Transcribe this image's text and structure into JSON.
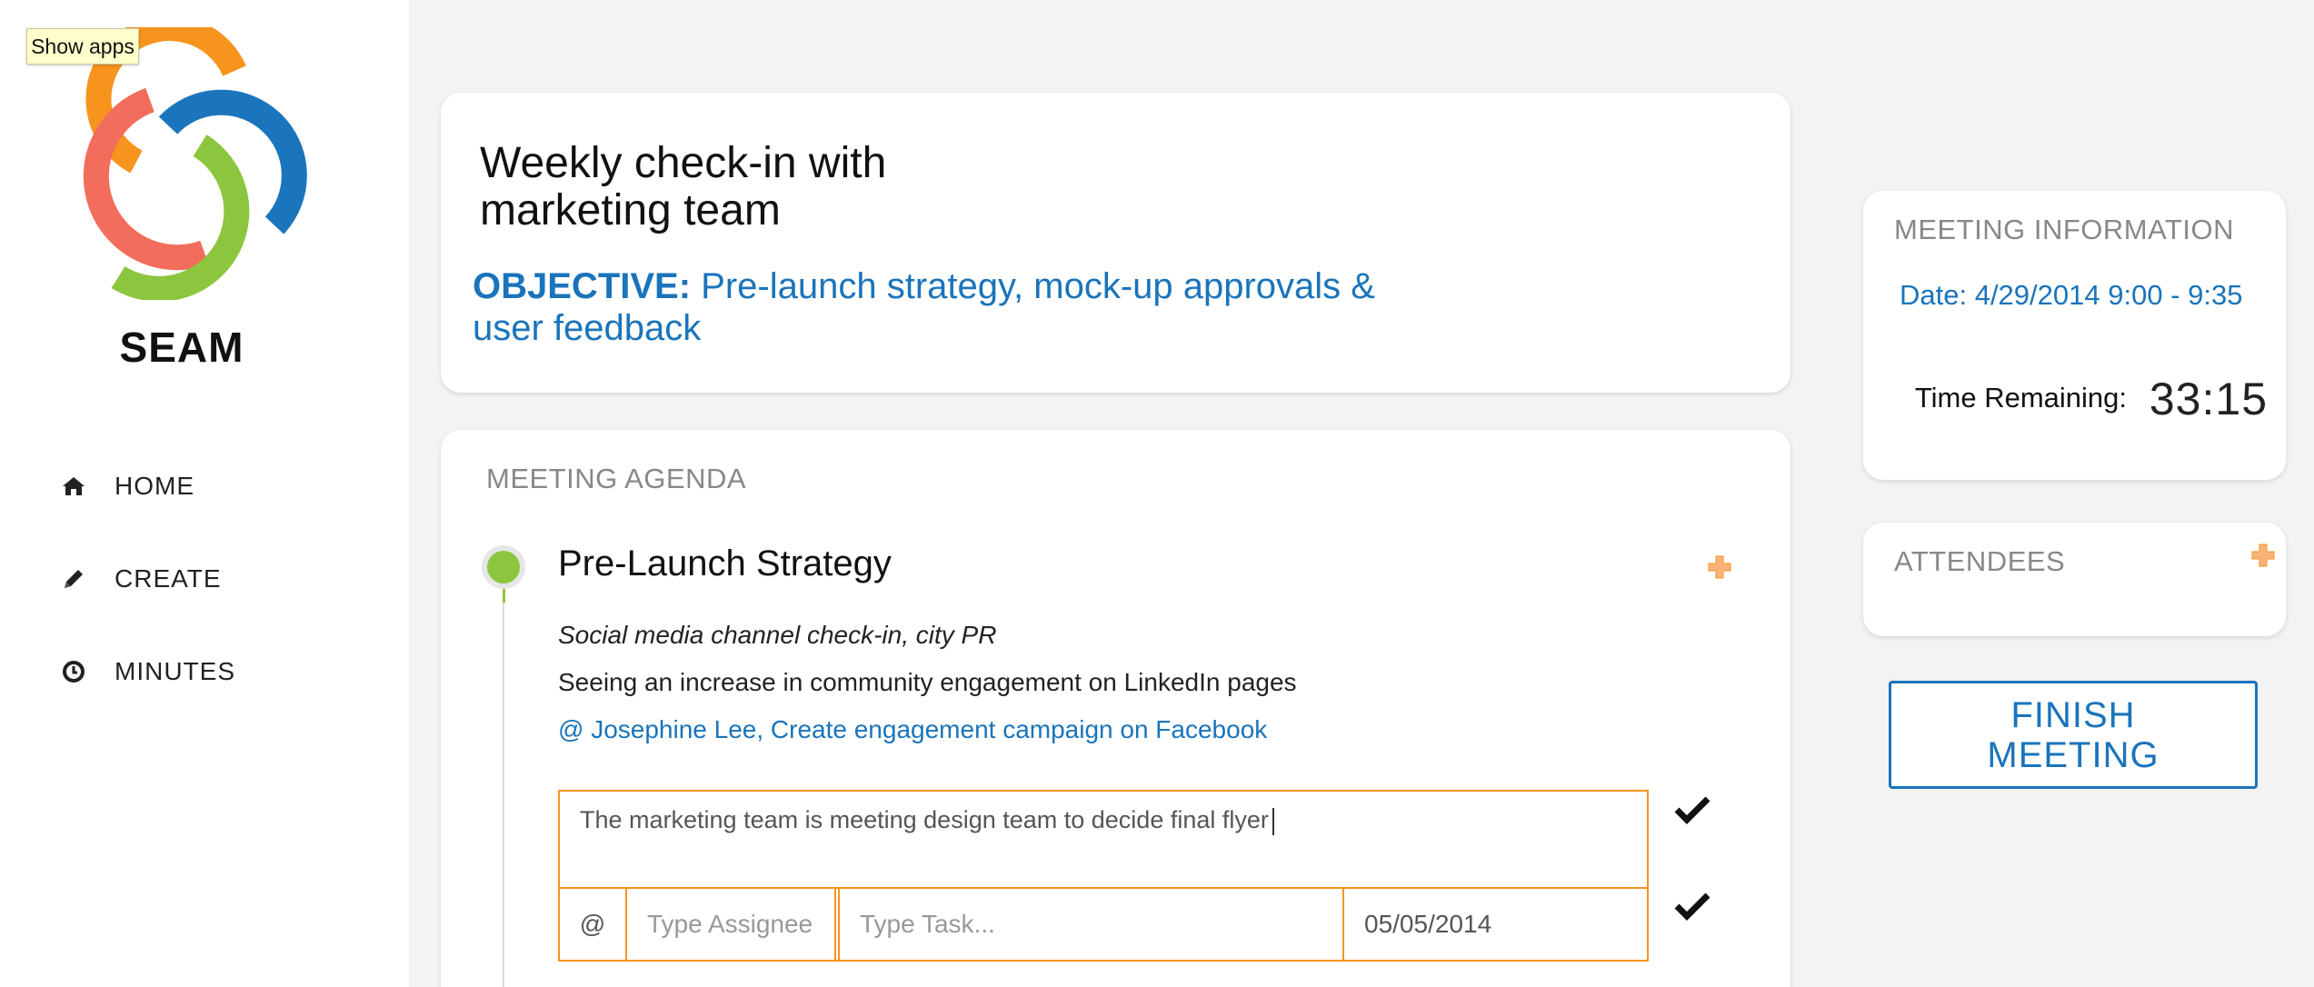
{
  "sidebar": {
    "tooltip": "Show apps",
    "brand": "SEAM",
    "nav": [
      {
        "label": "HOME",
        "icon": "home-icon"
      },
      {
        "label": "CREATE",
        "icon": "pencil-icon"
      },
      {
        "label": "MINUTES",
        "icon": "clock-icon"
      }
    ],
    "logo_colors": [
      "#f7941d",
      "#1b75bc",
      "#f26d5b",
      "#8cc63f"
    ]
  },
  "meeting": {
    "title": "Weekly check-in with marketing team",
    "objective_label": "OBJECTIVE:",
    "objective_text": " Pre-launch strategy, mock-up approvals & user feedback"
  },
  "agenda": {
    "header": "MEETING AGENDA",
    "item": {
      "title": "Pre-Launch Strategy",
      "subtitle": "Social media channel check-in, city PR",
      "note": "Seeing an increase in community engagement on LinkedIn pages",
      "task": "@ Josephine Lee, Create engagement campaign on Facebook",
      "note_input_value": "The marketing team is meeting design team to decide final flyer",
      "task_form": {
        "at_symbol": "@",
        "assignee_placeholder": "Type Assignee",
        "task_placeholder": "Type Task...",
        "date_value": "05/05/2014"
      }
    }
  },
  "info": {
    "header": "MEETING INFORMATION",
    "date": "Date: 4/29/2014 9:00 - 9:35",
    "time_label": "Time Remaining:",
    "time_value": "33:15"
  },
  "attendees": {
    "header": "ATTENDEES"
  },
  "finish_button": "FINISH MEETING",
  "colors": {
    "accent": "#1a74bb",
    "orange": "#f7941d",
    "green": "#8cc63f"
  }
}
